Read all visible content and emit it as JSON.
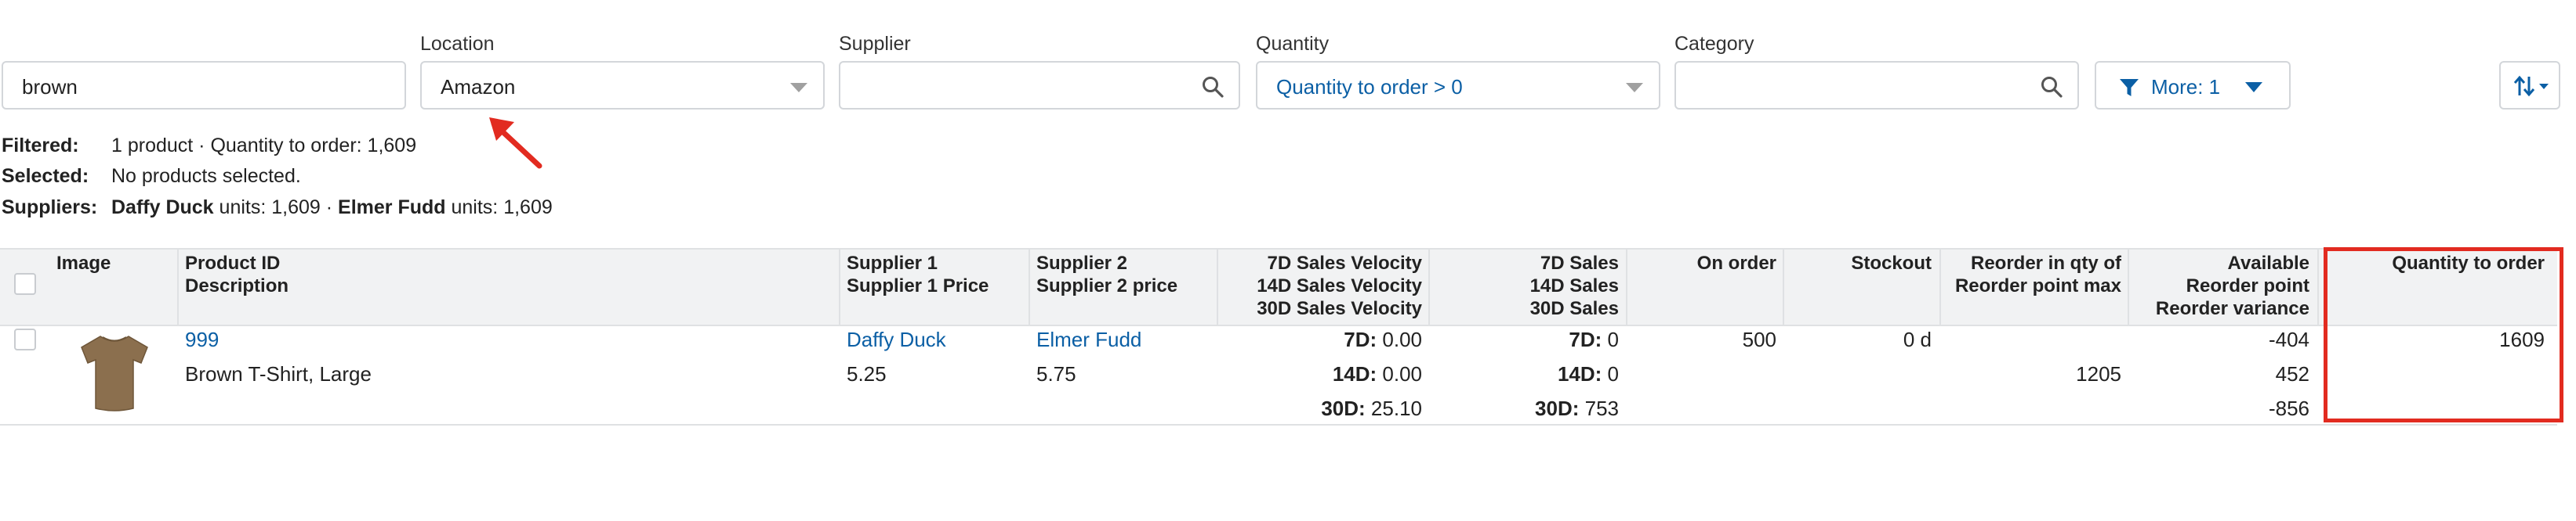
{
  "filters": {
    "search": {
      "value": "brown"
    },
    "location": {
      "label": "Location",
      "value": "Amazon"
    },
    "supplier": {
      "label": "Supplier",
      "value": ""
    },
    "quantity": {
      "label": "Quantity",
      "value": "Quantity to order > 0"
    },
    "category": {
      "label": "Category",
      "value": ""
    },
    "more_button": {
      "label": "More: 1"
    },
    "sort_button": {
      "icon": "sort-icon"
    }
  },
  "summary": {
    "filtered_label": "Filtered:",
    "filtered_value": "1 product · Quantity to order: 1,609",
    "selected_label": "Selected:",
    "selected_value": "No products selected.",
    "suppliers_label": "Suppliers:",
    "supplier1_name": "Daffy Duck",
    "supplier1_units": " units: 1,609 · ",
    "supplier2_name": "Elmer Fudd",
    "supplier2_units": " units: 1,609"
  },
  "table": {
    "headers": {
      "image": "Image",
      "product_id": "Product ID",
      "description": "Description",
      "supplier1": "Supplier 1",
      "supplier1_price": "Supplier 1 Price",
      "supplier2": "Supplier 2",
      "supplier2_price": "Supplier 2 price",
      "velocity_7d": "7D Sales Velocity",
      "velocity_14d": "14D Sales Velocity",
      "velocity_30d": "30D Sales Velocity",
      "sales_7d": "7D Sales",
      "sales_14d": "14D Sales",
      "sales_30d": "30D Sales",
      "on_order": "On order",
      "stockout": "Stockout",
      "reorder_qty": "Reorder in qty of",
      "reorder_max": "Reorder point max",
      "available": "Available",
      "reorder_point": "Reorder point",
      "reorder_variance": "Reorder variance",
      "qty_to_order": "Quantity to order"
    },
    "rows": [
      {
        "product_id": "999",
        "description": "Brown T-Shirt, Large",
        "supplier1": "Daffy Duck",
        "supplier1_price": "5.25",
        "supplier2": "Elmer Fudd",
        "supplier2_price": "5.75",
        "vel_7d_label": "7D:",
        "vel_7d": " 0.00",
        "vel_14d_label": "14D:",
        "vel_14d": " 0.00",
        "vel_30d_label": "30D:",
        "vel_30d": " 25.10",
        "sales_7d_label": "7D:",
        "sales_7d": " 0",
        "sales_14d_label": "14D:",
        "sales_14d": " 0",
        "sales_30d_label": "30D:",
        "sales_30d": " 753",
        "on_order": "500",
        "stockout": "0 d",
        "reorder_qty": "",
        "reorder_max": "1205",
        "available": "-404",
        "reorder_point": "452",
        "reorder_variance": "-856",
        "qty_to_order": "1609",
        "image_icon": "brown-tshirt-thumbnail"
      }
    ]
  },
  "colors": {
    "link": "#0b5fa5",
    "highlight": "#e22b20",
    "header_bg": "#f1f2f3"
  }
}
